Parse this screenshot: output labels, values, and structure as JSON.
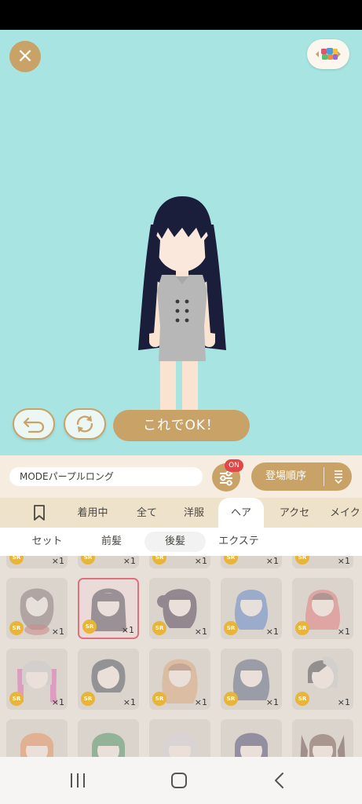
{
  "stage": {
    "background": "#a8e5e2",
    "close_icon": "×",
    "ok_label": "これでOK！"
  },
  "outfit_name": "MODEパープルロング",
  "filter": {
    "badge": "ON"
  },
  "sort": {
    "label": "登場順序"
  },
  "tabs": [
    {
      "label": "着用中"
    },
    {
      "label": "全て"
    },
    {
      "label": "洋服"
    },
    {
      "label": "ヘア"
    },
    {
      "label": "アクセ"
    },
    {
      "label": "メイク"
    }
  ],
  "active_tab": "ヘア",
  "subtabs": [
    {
      "label": "セット"
    },
    {
      "label": "前髪"
    },
    {
      "label": "後髪"
    },
    {
      "label": "エクステ"
    }
  ],
  "active_subtab": "後髪",
  "items": {
    "rarity": "SR",
    "quantity": "×1"
  },
  "colors": {
    "accent": "#c9a267",
    "badge": "#e04848",
    "sr_badge": "#e8b53a"
  }
}
